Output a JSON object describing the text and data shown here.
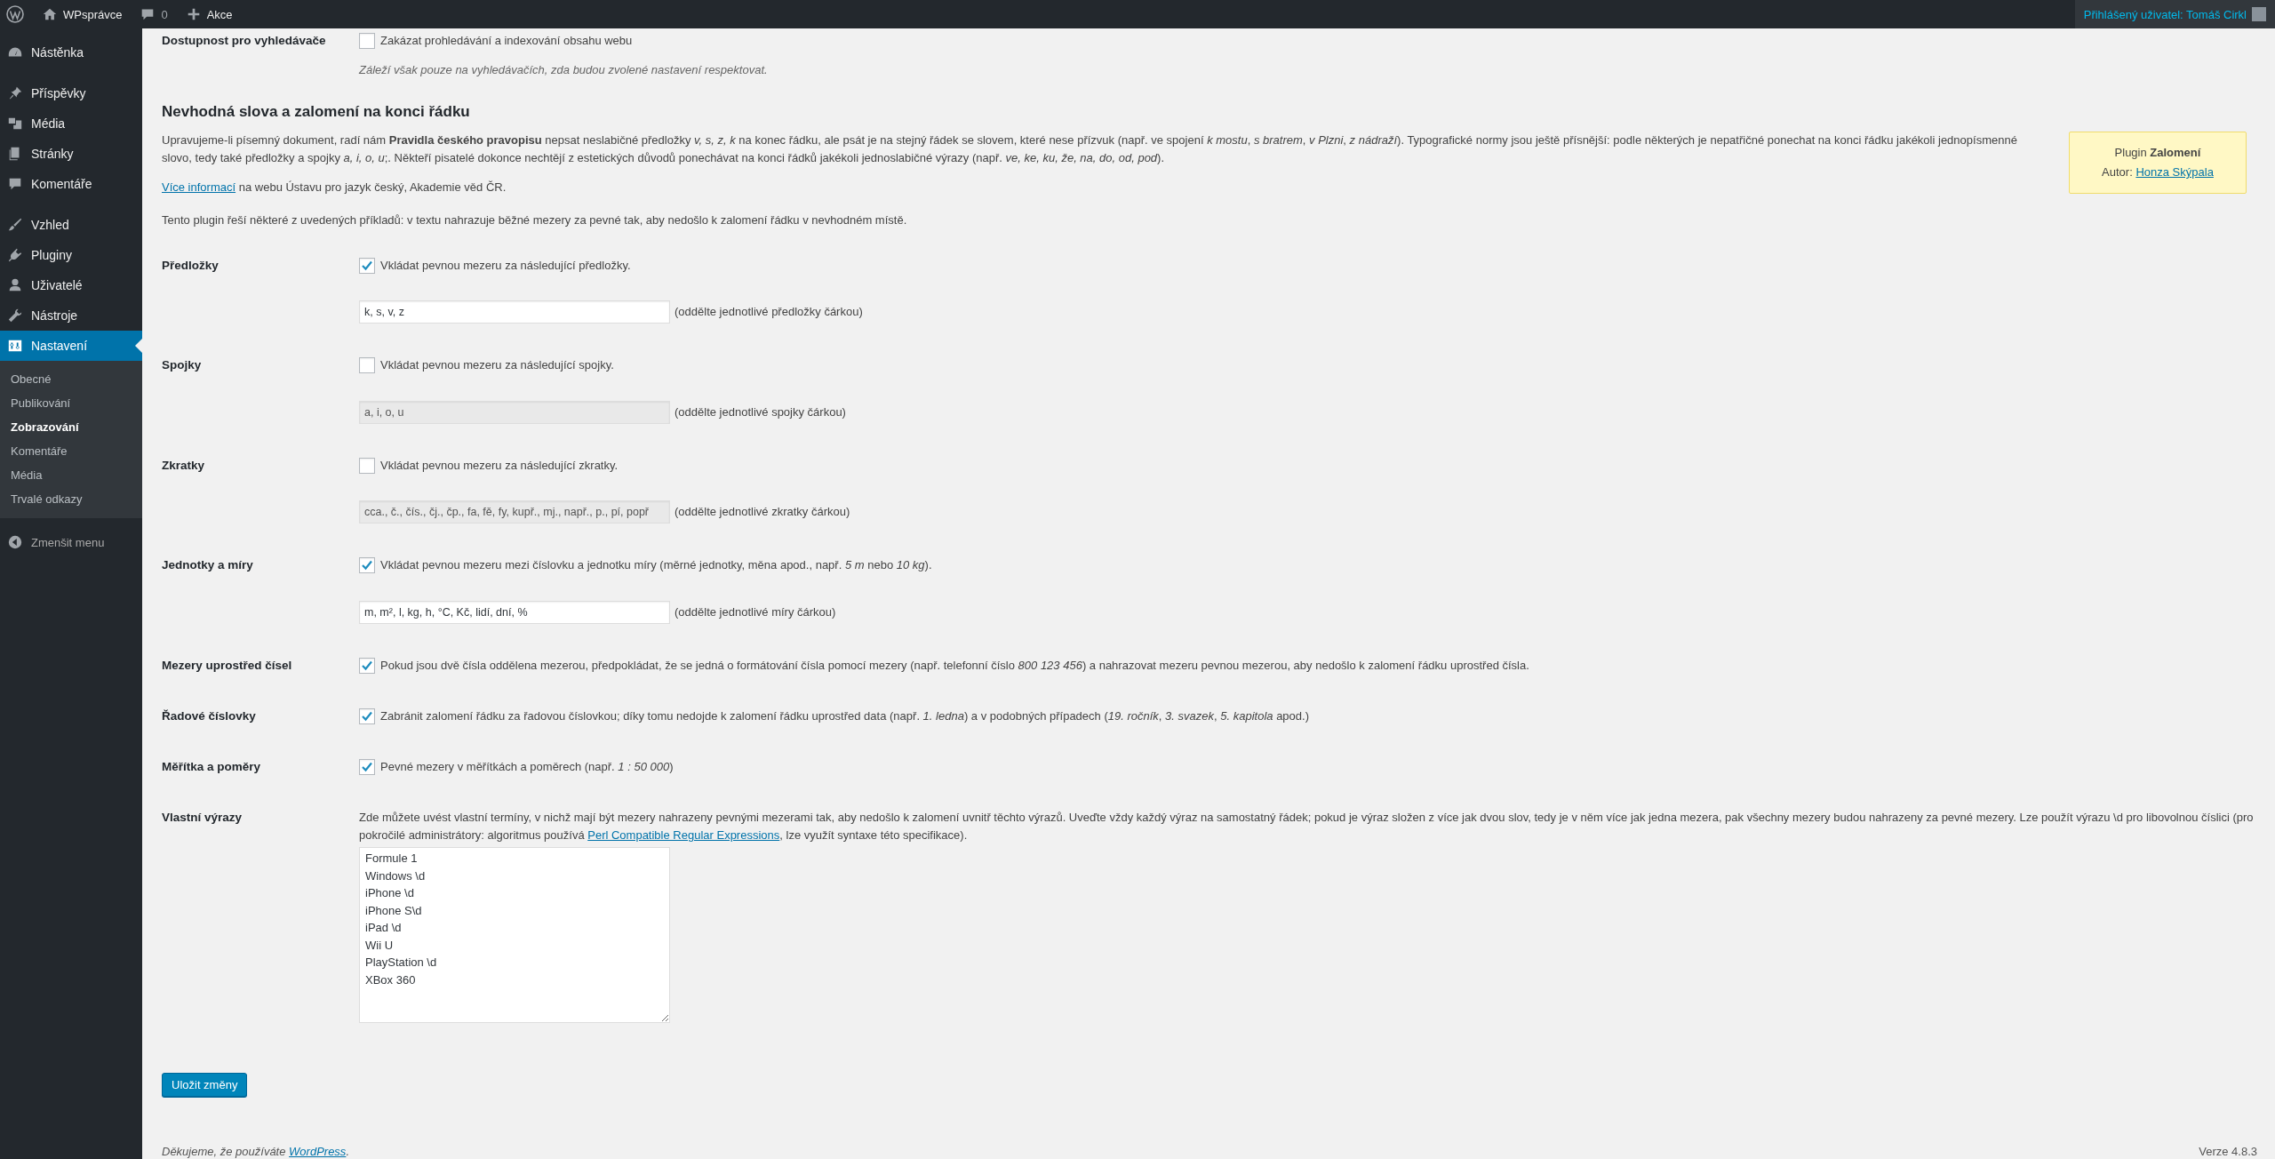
{
  "admin_bar": {
    "site_name": "WPsprávce",
    "comments_count": "0",
    "new_label": "Akce",
    "user_greeting": "Přihlášený uživatel: Tomáš Cirkl"
  },
  "sidebar": {
    "items": [
      {
        "label": "Nástěnka",
        "selected": false
      },
      {
        "label": "Příspěvky",
        "selected": false
      },
      {
        "label": "Média",
        "selected": false
      },
      {
        "label": "Stránky",
        "selected": false
      },
      {
        "label": "Komentáře",
        "selected": false
      },
      {
        "label": "Vzhled",
        "selected": false
      },
      {
        "label": "Pluginy",
        "selected": false
      },
      {
        "label": "Uživatelé",
        "selected": false
      },
      {
        "label": "Nástroje",
        "selected": false
      },
      {
        "label": "Nastavení",
        "selected": true
      }
    ],
    "submenu": [
      {
        "label": "Obecné",
        "selected": false
      },
      {
        "label": "Publikování",
        "selected": false
      },
      {
        "label": "Zobrazování",
        "selected": true
      },
      {
        "label": "Komentáře",
        "selected": false
      },
      {
        "label": "Média",
        "selected": false
      },
      {
        "label": "Trvalé odkazy",
        "selected": false
      }
    ],
    "collapse_label": "Zmenšit menu"
  },
  "search_visibility": {
    "label": "Dostupnost pro vyhledávače",
    "checkbox_label": "Zakázat prohledávání a indexování obsahu webu",
    "checked": false,
    "hint": "Záleží však pouze na vyhledávačích, zda budou zvolené nastavení respektovat."
  },
  "section": {
    "heading": "Nevhodná slova a zalomení na konci řádku",
    "intro": "Upravujeme-li písemný dokument, radí nám **Pravidla českého pravopisu** nepsat neslabičné předložky *v, s, z, k* na konec řádku, ale psát je na stejný řádek se slovem, které nese přízvuk (např. ve spojení *k mostu*, *s bratrem*, *v Plzni*, *z nádraží*). Typografické normy jsou ještě přísnější: podle některých je nepatřičné ponechat na konci řádku jakékoli jednopísmenné slovo, tedy také předložky a spojky *a, i, o, u*;. Někteří pisatelé dokonce nechtějí z estetických důvodů ponechávat na konci řádků jakékoli jednoslabičné výrazy (např. *ve, ke, ku, že, na, do, od, pod*).",
    "more_info_link": "Více informací",
    "more_info_rest": "na webu Ústavu pro jazyk český, Akademie věd ČR.",
    "plugin_note": "Tento plugin řeší některé z uvedených příkladů: v textu nahrazuje běžné mezery za pevné tak, aby nedošlo k zalomení řádku v nevhodném místě.",
    "plugin_box": {
      "prefix": "Plugin",
      "name": "Zalomení",
      "author_label": "Autor:",
      "author": "Honza Skýpala"
    }
  },
  "settings": [
    {
      "kind": "checkbox_input",
      "label": "Předložky",
      "checkbox_label": "Vkládat pevnou mezeru za následující předložky.",
      "checked": true,
      "field": {
        "value": "k, s, v, z",
        "disabled": false,
        "hint": "(oddělte jednotlivé předložky čárkou)"
      }
    },
    {
      "kind": "checkbox_input",
      "label": "Spojky",
      "checkbox_label": "Vkládat pevnou mezeru za následující spojky.",
      "checked": false,
      "field": {
        "value": "a, i, o, u",
        "disabled": true,
        "hint": "(oddělte jednotlivé spojky čárkou)"
      }
    },
    {
      "kind": "checkbox_input",
      "label": "Zkratky",
      "checkbox_label": "Vkládat pevnou mezeru za následující zkratky.",
      "checked": false,
      "field": {
        "value": "cca., č., čís., čj., čp., fa, fě, fy, kupř., mj., např., p., pí, popř",
        "disabled": true,
        "hint": "(oddělte jednotlivé zkratky čárkou)"
      }
    },
    {
      "kind": "checkbox_input",
      "label": "Jednotky a míry",
      "checkbox_label": "Vkládat pevnou mezeru mezi číslovku a jednotku míry (měrné jednotky, měna apod., např. *5 m* nebo *10 kg*).",
      "checked": true,
      "field": {
        "value": "m, m², l, kg, h, °C, Kč, lidí, dní, %",
        "disabled": false,
        "hint": "(oddělte jednotlivé míry čárkou)"
      }
    },
    {
      "kind": "checkbox",
      "label": "Mezery uprostřed čísel",
      "checkbox_label": "Pokud jsou dvě čísla oddělena mezerou, předpokládat, že se jedná o formátování čísla pomocí mezery (např. telefonní číslo *800 123 456*) a nahrazovat mezeru pevnou mezerou, aby nedošlo k zalomení řádku uprostřed čísla.",
      "checked": true
    },
    {
      "kind": "checkbox",
      "label": "Řadové číslovky",
      "checkbox_label": "Zabránit zalomení řádku za řadovou číslovkou; díky tomu nedojde k zalomení řádku uprostřed data (např. *1. ledna*) a v podobných případech (*19. ročník*, *3. svazek*, *5. kapitola* apod.)",
      "checked": true
    },
    {
      "kind": "checkbox",
      "label": "Měřítka a poměry",
      "checkbox_label": "Pevné mezery v měřítkách a poměrech (např. *1 : 50 000*)",
      "checked": true
    }
  ],
  "custom_terms": {
    "label": "Vlastní výrazy",
    "description_before": "Zde můžete uvést vlastní termíny, v nichž mají být mezery nahrazeny pevnými mezerami tak, aby nedošlo k zalomení uvnitř těchto výrazů. Uveďte vždy každý výraz na samostatný řádek; pokud je výraz složen z více jak dvou slov, tedy je v něm více jak jedna mezera, pak všechny mezery budou nahrazeny za pevné mezery. Lze použít výrazu \\d pro libovolnou číslici (pro pokročilé administrátory: algoritmus používá",
    "description_link": "Perl Compatible Regular Expressions",
    "description_after": ", lze využít syntaxe této specifikace).",
    "value": "Formule 1\nWindows \\d\niPhone \\d\niPhone S\\d\niPad \\d\nWii U\nPlayStation \\d\nXBox 360"
  },
  "save_button": "Uložit změny",
  "footer": {
    "thanks": "Děkujeme, že používáte",
    "link": "WordPress",
    "thanks_end": ".",
    "version": "Verze 4.8.3"
  }
}
